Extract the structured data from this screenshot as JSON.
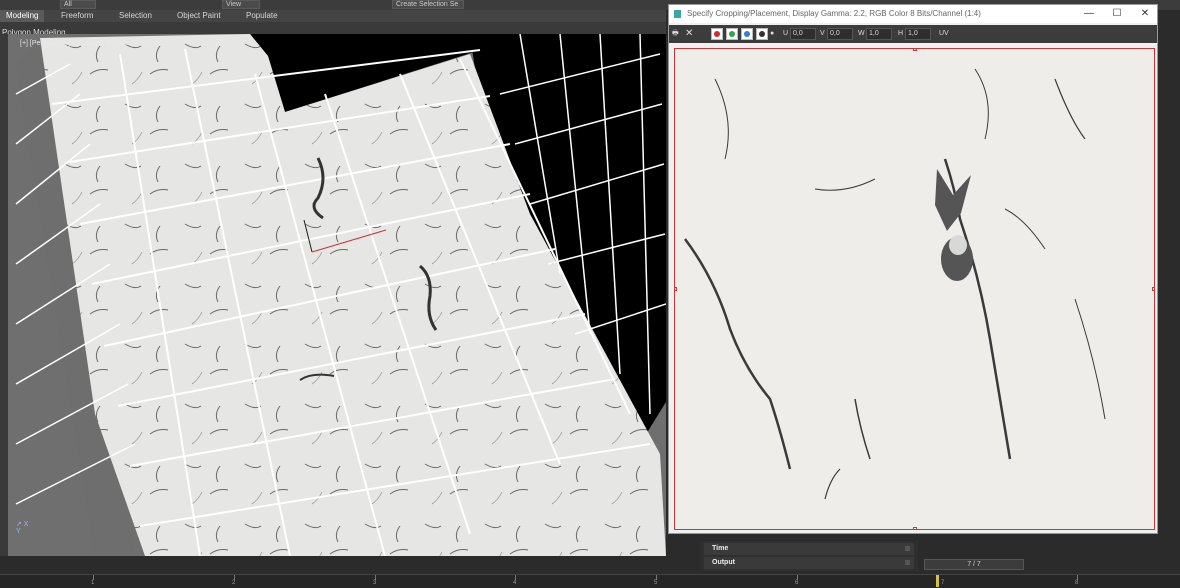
{
  "topbar": {
    "dropdown_all": "All",
    "dropdown_view": "View",
    "selection_set": "Create Selection Se"
  },
  "ribbon": {
    "tabs": [
      "Modeling",
      "Freeform",
      "Selection",
      "Object Paint",
      "Populate"
    ],
    "sub_label": "Polygon Modeling"
  },
  "viewport": {
    "label": "[+] [Perspective] [Standard] [Edged Faces]"
  },
  "dialog": {
    "title": "Specify Cropping/Placement, Display Gamma: 2.2, RGB Color 8 Bits/Channel (1:4)",
    "minimize": "—",
    "maximize": "☐",
    "close": "✕",
    "toolbar": {
      "u_label": "U",
      "u_value": "0,0",
      "v_label": "V",
      "v_value": "0,0",
      "w_label": "W",
      "w_value": "1,0",
      "h_label": "H",
      "h_value": "1,0",
      "uv_label": "UV"
    },
    "channel_colors": [
      "#d22b2b",
      "#2aa84a",
      "#2f7fd8",
      "#333333"
    ]
  },
  "rollouts": {
    "time": "Time",
    "output": "Output"
  },
  "frame": {
    "display": "7 / 7"
  },
  "timeline": {
    "ticks": [
      "1",
      "2",
      "3",
      "4",
      "5",
      "6",
      "7",
      "8"
    ]
  }
}
